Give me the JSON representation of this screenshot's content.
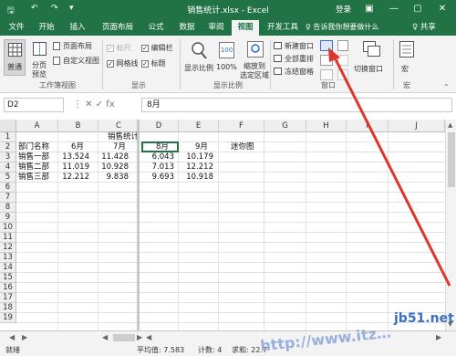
{
  "titlebar": {
    "title": "销售统计.xlsx - Excel",
    "login": "登录",
    "save_glyph": "🖫",
    "undo_glyph": "↶",
    "redo_glyph": "↷",
    "customize_glyph": "▾",
    "ribbon_opts_glyph": "▣",
    "minimize_glyph": "—",
    "restore_glyph": "▢",
    "close_glyph": "✕"
  },
  "tabs": [
    {
      "label": "文件"
    },
    {
      "label": "开始"
    },
    {
      "label": "插入"
    },
    {
      "label": "页面布局"
    },
    {
      "label": "公式"
    },
    {
      "label": "数据"
    },
    {
      "label": "审阅"
    },
    {
      "label": "视图",
      "active": true
    },
    {
      "label": "开发工具"
    }
  ],
  "tell_me": "♀ 告诉我你想要做什么",
  "share": "♀ 共享",
  "ribbon": {
    "workbook_views": {
      "normal": "普通",
      "page_break_line1": "分页",
      "page_break_line2": "预览",
      "page_layout": "页面布局",
      "custom_views": "自定义视图",
      "group_label": "工作簿视图"
    },
    "show": {
      "ruler": "标尺",
      "formula_bar": "编辑栏",
      "gridlines": "网格线",
      "headings": "标题",
      "group_label": "显示",
      "ruler_checked": true,
      "formula_bar_checked": true,
      "gridlines_checked": true,
      "headings_checked": true
    },
    "zoom": {
      "zoom_label": "显示比例",
      "hundred": "100%",
      "zoom_sel_line1": "缩放到",
      "zoom_sel_line2": "选定区域",
      "group_label": "显示比例"
    },
    "window": {
      "new_window": "新建窗口",
      "arrange_all": "全部重排",
      "freeze_panes": "冻结窗格",
      "switch_windows": "切换窗口",
      "group_label": "窗口"
    },
    "macros": {
      "label": "宏",
      "group_label": "宏"
    }
  },
  "formula_bar": {
    "name_box": "D2",
    "icons": "⋮   ✕   ✓   fx",
    "formula": "8月"
  },
  "sheet": {
    "columns": [
      "A",
      "B",
      "C",
      "D",
      "E",
      "F",
      "G",
      "H",
      "I",
      "J"
    ],
    "rows": [
      "1",
      "2",
      "3",
      "4",
      "5",
      "6",
      "7",
      "8",
      "9",
      "10",
      "11",
      "12",
      "13",
      "14",
      "15",
      "16",
      "17",
      "18",
      "19"
    ],
    "title": "销售统计",
    "headers": [
      "部门名称",
      "6月",
      "7月",
      "8月",
      "9月",
      "迷你图"
    ],
    "data": [
      [
        "销售一部",
        "13.524",
        "11.428",
        "6.043",
        "10.179"
      ],
      [
        "销售二部",
        "11.019",
        "10.928",
        "7.013",
        "12.212"
      ],
      [
        "销售三部",
        "12.212",
        "9.838",
        "9.693",
        "10.918"
      ]
    ]
  },
  "annotation": {
    "color": "#e0352b"
  },
  "statusbar": {
    "ready": "就绪",
    "average": "平均值: 7.583",
    "count": "计数: 4",
    "sum": "求和: 22.7"
  },
  "watermark": {
    "left_text": "http://www.itz…",
    "brand": "jb51.net"
  }
}
